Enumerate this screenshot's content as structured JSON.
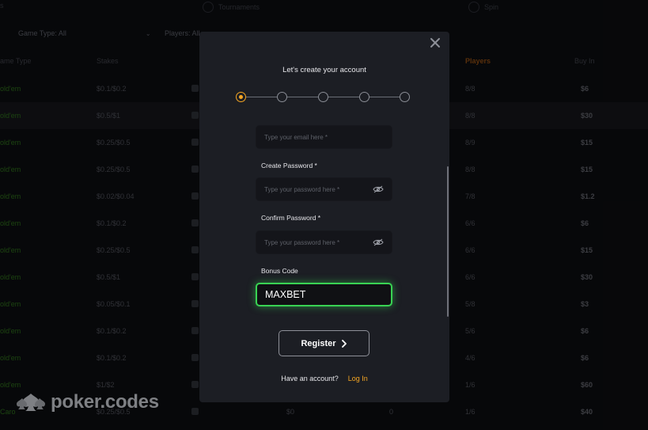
{
  "lobby": {
    "tabs": [
      {
        "label": "s",
        "icon": "tab-icon"
      },
      {
        "label": "Tournaments",
        "icon": "trophy-icon"
      },
      {
        "label": "Spin",
        "icon": "spin-icon"
      }
    ],
    "filters": {
      "game_type": "Game Type: All",
      "players": "Players: All"
    },
    "columns": {
      "game": "ame Type",
      "stakes": "Stakes",
      "players": "Players",
      "buyin": "Buy In"
    },
    "rows": [
      {
        "game": "old'em",
        "stakes": "$0.1/$0.2",
        "players": "8/8",
        "buyin": "$6"
      },
      {
        "game": "old'em",
        "stakes": "$0.5/$1",
        "players": "8/8",
        "buyin": "$30"
      },
      {
        "game": "old'em",
        "stakes": "$0.25/$0.5",
        "players": "8/9",
        "buyin": "$15"
      },
      {
        "game": "old'em",
        "stakes": "$0.25/$0.5",
        "players": "8/8",
        "buyin": "$15"
      },
      {
        "game": "old'em",
        "stakes": "$0.02/$0.04",
        "players": "7/8",
        "buyin": "$1.2"
      },
      {
        "game": "old'em",
        "stakes": "$0.1/$0.2",
        "players": "6/6",
        "buyin": "$6"
      },
      {
        "game": "old'em",
        "stakes": "$0.25/$0.5",
        "players": "6/6",
        "buyin": "$15"
      },
      {
        "game": "old'em",
        "stakes": "$0.5/$1",
        "players": "6/6",
        "buyin": "$30"
      },
      {
        "game": "old'em",
        "stakes": "$0.05/$0.1",
        "players": "5/8",
        "buyin": "$3"
      },
      {
        "game": "old'em",
        "stakes": "$0.1/$0.2",
        "players": "5/6",
        "buyin": "$6"
      },
      {
        "game": "old'em",
        "stakes": "$0.1/$0.2",
        "players": "4/6",
        "buyin": "$6"
      },
      {
        "game": "old'em",
        "stakes": "$1/$2",
        "players": "1/6",
        "buyin": "$60"
      },
      {
        "game": "Caro",
        "stakes": "$0.25/$0.5",
        "players": "1/6",
        "buyin": "$40",
        "extra1": "$0",
        "extra2": "0"
      }
    ]
  },
  "watermark": {
    "text": "poker.codes"
  },
  "modal": {
    "title": "Let's create your account",
    "steps": {
      "total": 5,
      "current": 1
    },
    "email": {
      "placeholder": "Type your email here *",
      "value": ""
    },
    "password": {
      "label": "Create Password *",
      "placeholder": "Type your password here *"
    },
    "confirm": {
      "label": "Confirm Password *",
      "placeholder": "Type your password here *"
    },
    "bonus": {
      "label": "Bonus Code",
      "value": "MAXBET"
    },
    "register_label": "Register",
    "have_account": "Have an account?",
    "login_label": "Log In"
  },
  "colors": {
    "accent": "#f5a623",
    "bonus_glow": "#39d353"
  }
}
